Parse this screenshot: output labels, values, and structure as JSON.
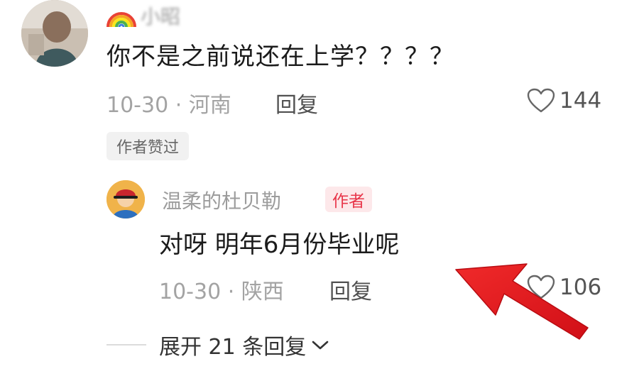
{
  "comment": {
    "username": "小昭",
    "text": "你不是之前说还在上学？？？？",
    "meta": "10-30 · 河南",
    "reply_label": "回复",
    "like_count": "144",
    "author_liked_badge": "作者赞过"
  },
  "reply": {
    "username": "温柔的杜贝勒",
    "author_badge": "作者",
    "text": "对呀 明年6月份毕业呢",
    "meta": "10-30 · 陕西",
    "reply_label": "回复",
    "like_count": "106"
  },
  "expand_replies_label": "展开 21 条回复",
  "colors": {
    "author_badge_bg": "#fde8ea",
    "author_badge_text": "#e8364a",
    "annotation_arrow": "#e8161e"
  },
  "icons": {
    "like": "heart-outline-icon",
    "expand": "chevron-down-icon",
    "username_prefix": "rainbow-emoji-icon"
  }
}
